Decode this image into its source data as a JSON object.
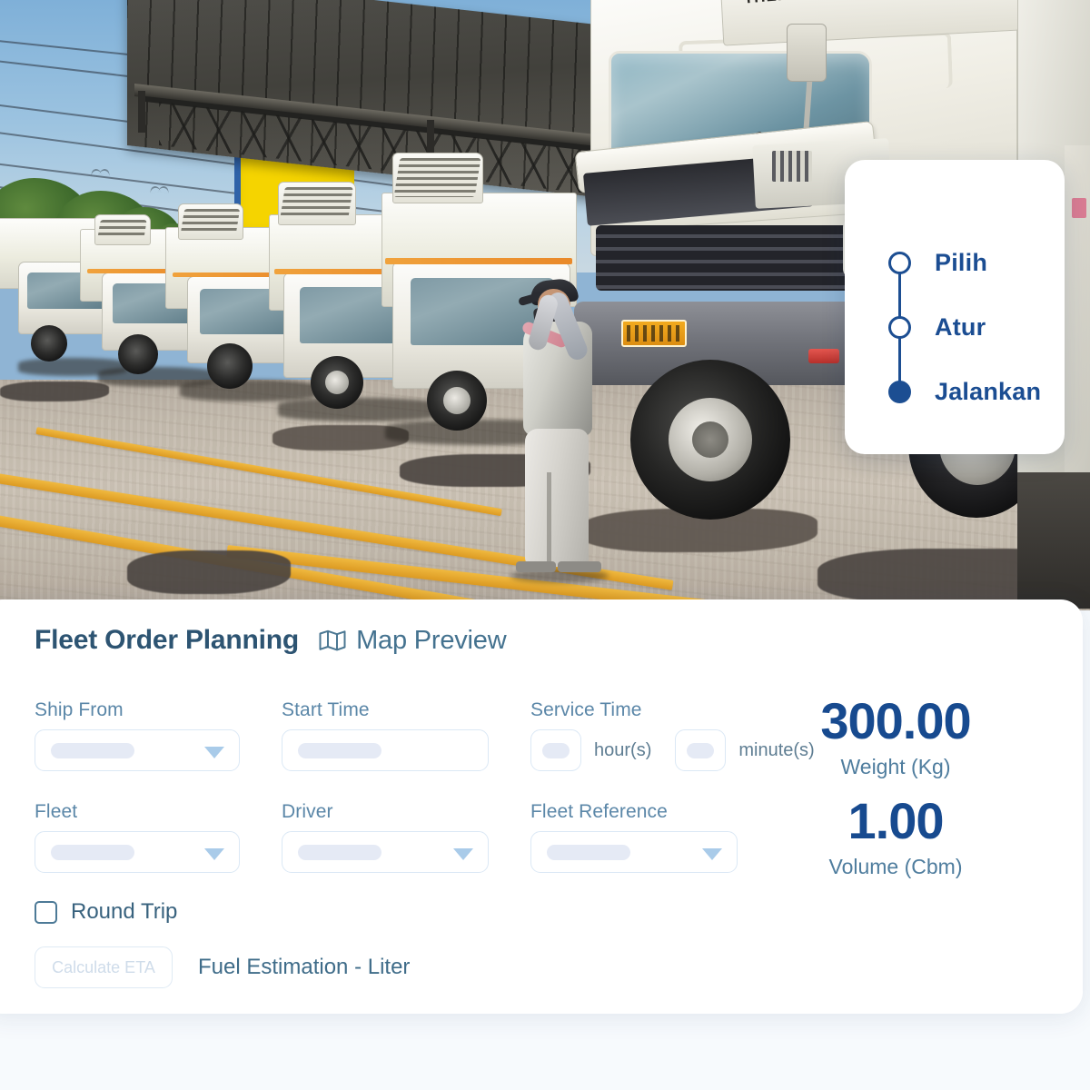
{
  "hero": {
    "alt": "fleet of white refrigerated box trucks parked under a depot canopy while a worker in grey coveralls opens the hood of the nearest truck",
    "truck_unit_label": "THERMO KING"
  },
  "stepper": {
    "steps": [
      {
        "label": "Pilih",
        "state": "pending"
      },
      {
        "label": "Atur",
        "state": "pending"
      },
      {
        "label": "Jalankan",
        "state": "active"
      }
    ],
    "accent_color": "#1c4e92"
  },
  "card": {
    "title": "Fleet Order Planning",
    "map_preview": "Map Preview",
    "map_icon": "map-icon"
  },
  "fields": {
    "ship_from": {
      "label": "Ship From",
      "value": "",
      "placeholder": ""
    },
    "start_time": {
      "label": "Start Time",
      "value": "",
      "placeholder": ""
    },
    "service_time": {
      "label": "Service Time",
      "hours_value": "",
      "hours_unit": "hour(s)",
      "minutes_value": "",
      "minutes_unit": "minute(s)"
    },
    "fleet": {
      "label": "Fleet",
      "value": "",
      "placeholder": ""
    },
    "driver": {
      "label": "Driver",
      "value": "",
      "placeholder": ""
    },
    "fleet_reference": {
      "label": "Fleet Reference",
      "value": "",
      "placeholder": ""
    }
  },
  "kpis": [
    {
      "value": "300.00",
      "label": "Weight (Kg)"
    },
    {
      "value": "1.00",
      "label": "Volume (Cbm)"
    }
  ],
  "controls": {
    "round_trip": {
      "label": "Round Trip",
      "checked": false
    },
    "calculate_eta": {
      "label": "Calculate ETA",
      "disabled": true
    },
    "fuel_estimation": "Fuel Estimation - Liter"
  },
  "colors": {
    "accent_blue": "#1c4e92",
    "kpi_blue": "#174a8f",
    "label_blue": "#5b87a8",
    "title_slate": "#2d5472",
    "field_border": "#dbe8f5",
    "skeleton": "#e5eaf5"
  }
}
